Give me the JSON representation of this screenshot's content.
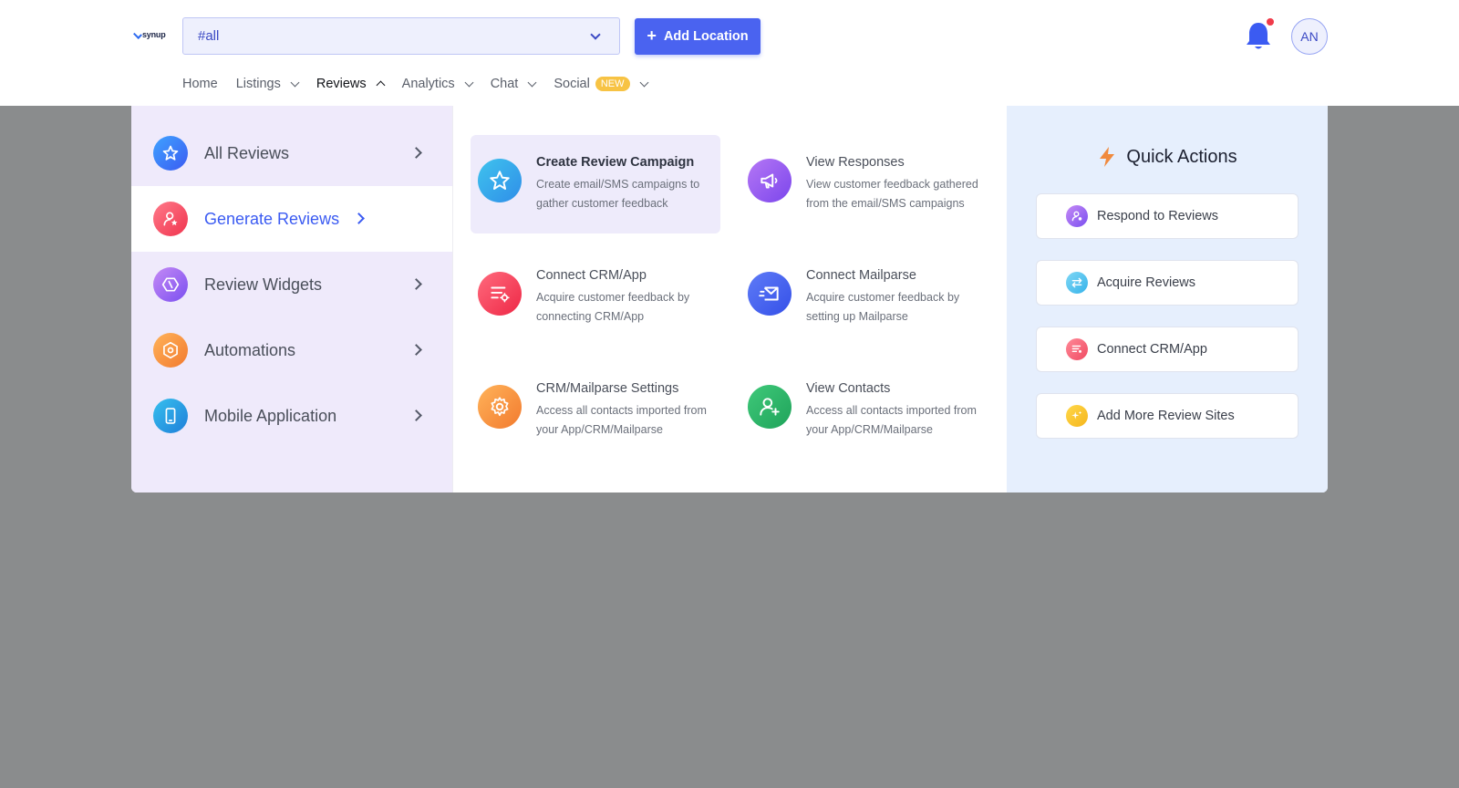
{
  "header": {
    "logo_text": "synup",
    "location_select": {
      "value": "#all"
    },
    "add_location_label": "Add Location",
    "avatar_initials": "AN"
  },
  "nav": {
    "home": "Home",
    "listings": "Listings",
    "reviews": "Reviews",
    "analytics": "Analytics",
    "chat": "Chat",
    "social": "Social",
    "social_badge": "NEW"
  },
  "left_menu": {
    "items": [
      {
        "label": "All Reviews",
        "icon": "star-icon"
      },
      {
        "label": "Generate Reviews",
        "icon": "user-star-icon",
        "active": true
      },
      {
        "label": "Review Widgets",
        "icon": "widget-icon"
      },
      {
        "label": "Automations",
        "icon": "hexagon-gear-icon"
      },
      {
        "label": "Mobile Application",
        "icon": "mobile-icon"
      }
    ]
  },
  "cards": {
    "items": [
      {
        "title": "Create Review Campaign",
        "desc": "Create email/SMS campaigns to gather customer feedback",
        "icon": "star-icon",
        "highlighted": true
      },
      {
        "title": "View Responses",
        "desc": "View customer feedback gathered from the email/SMS campaigns",
        "icon": "megaphone-icon"
      },
      {
        "title": "Connect CRM/App",
        "desc": "Acquire customer feedback by connecting CRM/App",
        "icon": "list-settings-icon"
      },
      {
        "title": "Connect Mailparse",
        "desc": "Acquire customer feedback by setting up Mailparse",
        "icon": "mail-icon"
      },
      {
        "title": "CRM/Mailparse Settings",
        "desc": "Access all contacts imported from your App/CRM/Mailparse",
        "icon": "gear-icon"
      },
      {
        "title": "View Contacts",
        "desc": "Access all contacts imported from your App/CRM/Mailparse",
        "icon": "user-plus-icon"
      }
    ]
  },
  "quick_actions": {
    "title": "Quick Actions",
    "items": [
      {
        "label": "Respond to Reviews",
        "icon": "user-star-icon"
      },
      {
        "label": "Acquire Reviews",
        "icon": "arrows-icon"
      },
      {
        "label": "Connect CRM/App",
        "icon": "list-settings-icon"
      },
      {
        "label": "Add More Review Sites",
        "icon": "sparkle-icon"
      }
    ]
  },
  "colors": {
    "accent": "#4a63f0",
    "left_panel_bg": "#efeafb",
    "right_panel_bg": "#e6effd",
    "overlay": "#8a8c8d",
    "notification_dot": "#f03b4a"
  }
}
